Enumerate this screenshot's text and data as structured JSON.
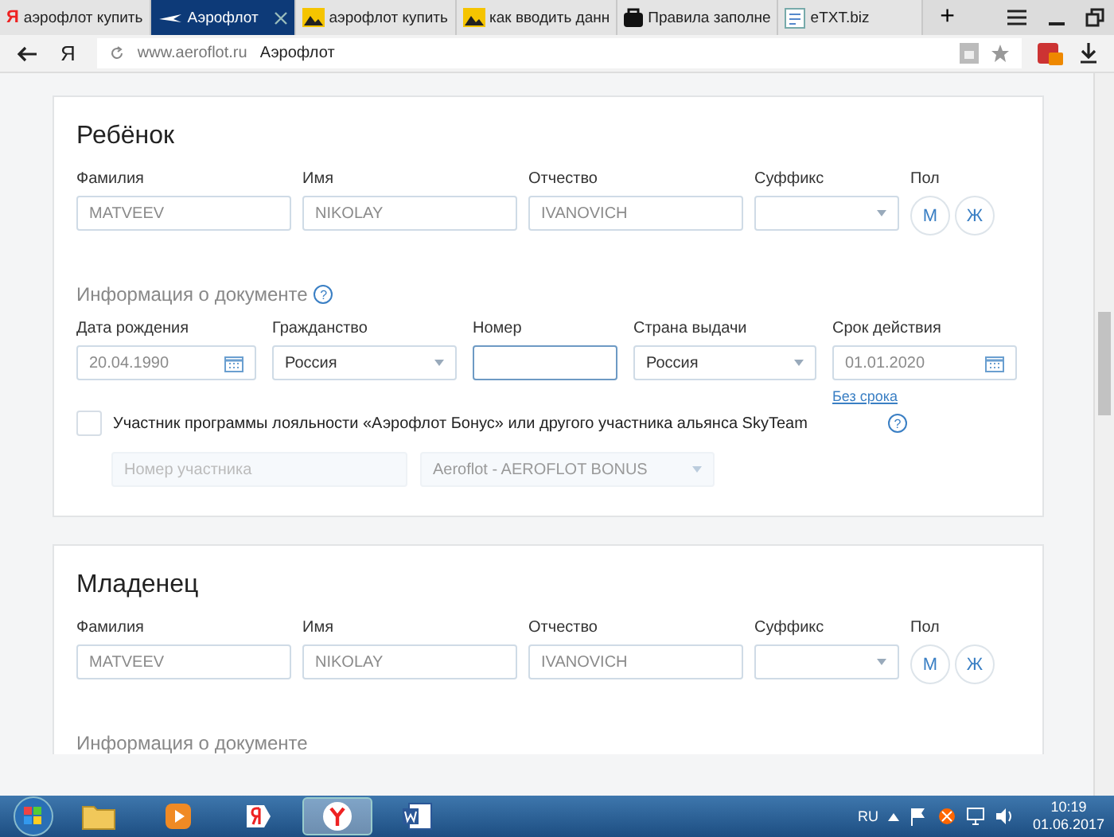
{
  "tabs": [
    {
      "label": "аэрофлот купить",
      "kind": "yandex",
      "logo": "Я",
      "selected": false
    },
    {
      "label": "Аэрофлот",
      "kind": "plane",
      "selected": true
    },
    {
      "label": "аэрофлот купить",
      "kind": "image",
      "selected": false
    },
    {
      "label": "как вводить данн",
      "kind": "image",
      "selected": false
    },
    {
      "label": "Правила заполне",
      "kind": "bag",
      "selected": false
    },
    {
      "label": "eTXT.biz",
      "kind": "note",
      "selected": false
    }
  ],
  "new_tab": "+",
  "address_bar": {
    "logo": "Я",
    "url": "www.aeroflot.ru",
    "page_title": "Аэрофлот"
  },
  "sections": [
    {
      "title": "Ребёнок",
      "name_fields": [
        {
          "label": "Фамилия",
          "value": "MATVEEV",
          "kind": "text"
        },
        {
          "label": "Имя",
          "value": "NIKOLAY",
          "kind": "text"
        },
        {
          "label": "Отчество",
          "value": "IVANOVICH",
          "kind": "text"
        },
        {
          "label": "Суффикс",
          "kind": "select"
        }
      ],
      "gender": {
        "label": "Пол",
        "options": [
          {
            "label": "М",
            "selected": false
          },
          {
            "label": "Ж",
            "selected": false
          }
        ]
      },
      "document": {
        "heading": "Информация о документе",
        "help": "?",
        "fields": [
          {
            "label": "Дата рождения",
            "value": "20.04.1990",
            "kind": "date",
            "focused": false
          },
          {
            "label": "Гражданство",
            "value": "Россия",
            "kind": "select",
            "focused": false
          },
          {
            "label": "Номер",
            "kind": "text",
            "focused": true
          },
          {
            "label": "Страна выдачи",
            "value": "Россия",
            "kind": "select",
            "focused": false
          },
          {
            "label": "Срок действия",
            "value": "01.01.2020",
            "kind": "date",
            "focused": false,
            "link": "Без срока"
          }
        ]
      },
      "loyalty": {
        "label": "Участник программы лояльности «Аэрофлот Бонус» или другого участника альянса SkyTeam",
        "help": "?",
        "checked": false,
        "member_field": {
          "placeholder": "Номер участника",
          "disabled": true
        },
        "program_select": {
          "value": "Aeroflot - AEROFLOT BONUS",
          "disabled": true
        }
      }
    },
    {
      "title": "Младенец",
      "name_fields": [
        {
          "label": "Фамилия",
          "value": "MATVEEV",
          "kind": "text"
        },
        {
          "label": "Имя",
          "value": "NIKOLAY",
          "kind": "text"
        },
        {
          "label": "Отчество",
          "value": "IVANOVICH",
          "kind": "text"
        },
        {
          "label": "Суффикс",
          "kind": "select"
        }
      ],
      "gender": {
        "label": "Пол",
        "options": [
          {
            "label": "М",
            "selected": false
          },
          {
            "label": "Ж",
            "selected": false
          }
        ]
      },
      "document": {
        "heading": "Информация о документе"
      }
    }
  ],
  "taskbar": {
    "apps": [
      {
        "kind": "folder",
        "selected": false
      },
      {
        "kind": "media",
        "selected": false
      },
      {
        "kind": "yandex",
        "selected": false
      },
      {
        "kind": "browser",
        "selected": true
      },
      {
        "kind": "word",
        "selected": false
      }
    ],
    "language": "RU",
    "time": "10:19",
    "date": "01.06.2017"
  }
}
